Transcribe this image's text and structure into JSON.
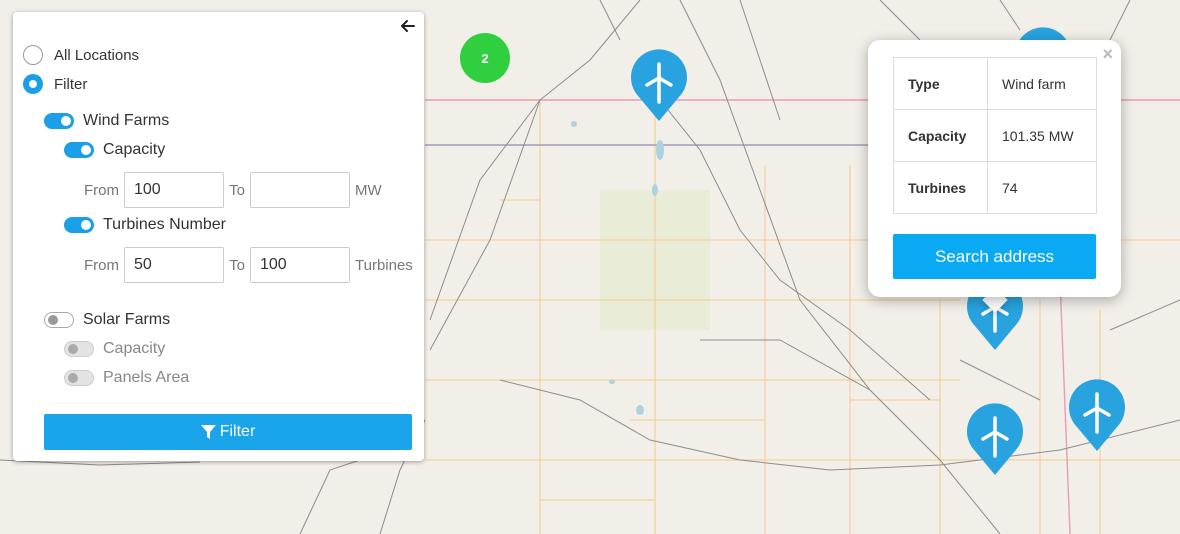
{
  "map": {
    "background": "#f2efe9",
    "cluster": {
      "count": "2",
      "color": "#2fcf3f"
    },
    "marker_icon": "wind-turbine-icon",
    "marker_color": "#29a3e0"
  },
  "panel": {
    "back_icon": "arrow-left-icon",
    "radio_all": "All Locations",
    "radio_filter": "Filter",
    "wind": {
      "label": "Wind Farms",
      "capacity_label": "Capacity",
      "capacity_from_label": "From",
      "capacity_from": "100",
      "capacity_to_label": "To",
      "capacity_to": "",
      "capacity_unit": "MW",
      "turbines_label": "Turbines Number",
      "turbines_from_label": "From",
      "turbines_from": "50",
      "turbines_to_label": "To",
      "turbines_to": "100",
      "turbines_unit": "Turbines"
    },
    "solar": {
      "label": "Solar Farms",
      "capacity_label": "Capacity",
      "panels_label": "Panels Area"
    },
    "filter_button": "Filter",
    "filter_icon": "funnel-icon",
    "accent": "#1b9fe6"
  },
  "popup": {
    "close": "×",
    "rows": [
      {
        "key": "Type",
        "value": "Wind farm"
      },
      {
        "key": "Capacity",
        "value": "101.35 MW"
      },
      {
        "key": "Turbines",
        "value": "74"
      }
    ],
    "search_button": "Search address"
  }
}
